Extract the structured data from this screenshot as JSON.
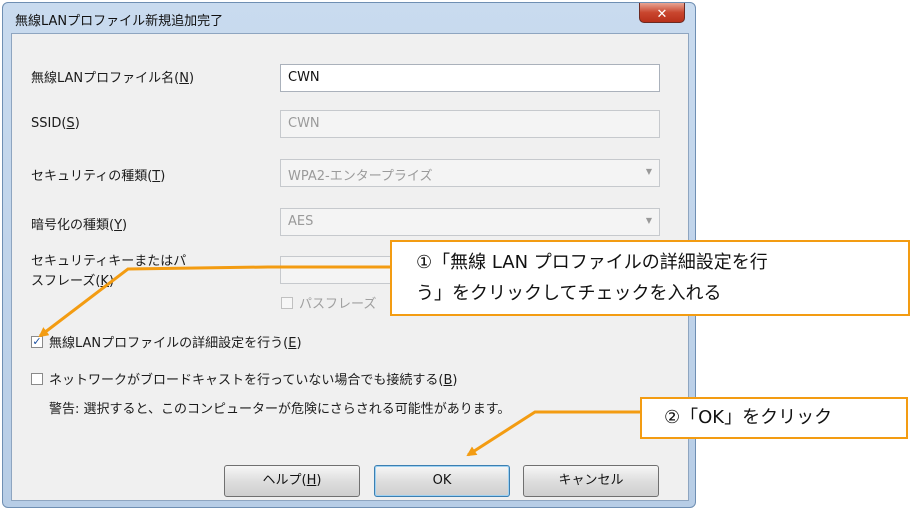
{
  "window": {
    "title": "無線LANプロファイル新規追加完了",
    "close_glyph": "✕"
  },
  "form": {
    "profile_name": {
      "label_text": "無線LANプロファイル名(",
      "mnemonic": "N",
      "value": "CWN"
    },
    "ssid": {
      "label_text": "SSID(",
      "mnemonic": "S",
      "value": "CWN"
    },
    "security_type": {
      "label_text": "セキュリティの種類(",
      "mnemonic": "T",
      "value": "WPA2-エンタープライズ"
    },
    "encryption_type": {
      "label_text": "暗号化の種類(",
      "mnemonic": "Y",
      "value": "AES"
    },
    "security_key": {
      "label_line1": "セキュリティキーまたはパ",
      "label_line2": "スフレーズ(",
      "mnemonic": "K",
      "value": ""
    },
    "show_passphrase": {
      "label": "パスフレーズ",
      "checked": false
    }
  },
  "checkboxes": {
    "detail_settings": {
      "label_text": "無線LANプロファイルの詳細設定を行う(",
      "mnemonic": "E",
      "checked": true,
      "check_glyph": "✓"
    },
    "connect_non_broadcast": {
      "label_text": "ネットワークがブロードキャストを行っていない場合でも接続する(",
      "mnemonic": "B",
      "checked": false
    }
  },
  "warning": "警告: 選択すると、このコンピューターが危険にさらされる可能性があります。",
  "buttons": {
    "help": {
      "label_text": "ヘルプ(",
      "mnemonic": "H"
    },
    "ok": {
      "label": "OK"
    },
    "cancel": {
      "label": "キャンセル"
    }
  },
  "annotations": {
    "callout1": {
      "line1": "①「無線 LAN プロファイルの詳細設定を行",
      "line2": "う」をクリックしてチェックを入れる"
    },
    "callout2": {
      "text": "②「OK」をクリック"
    },
    "accent_color": "#f39c12"
  },
  "close_paren": ")"
}
